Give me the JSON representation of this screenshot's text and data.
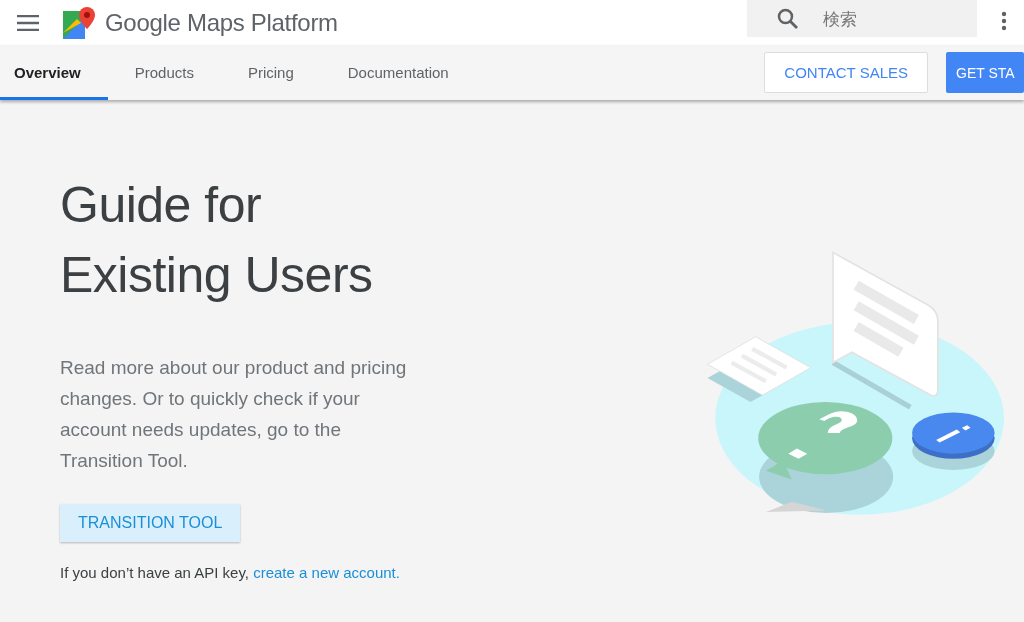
{
  "header": {
    "brand": "Google Maps Platform",
    "search": {
      "placeholder": "検索"
    }
  },
  "tabs": [
    {
      "label": "Overview",
      "selected": true
    },
    {
      "label": "Products",
      "selected": false
    },
    {
      "label": "Pricing",
      "selected": false
    },
    {
      "label": "Documentation",
      "selected": false
    }
  ],
  "actions": [
    {
      "label": "CONTACT SALES",
      "kind": "outlined"
    },
    {
      "label": "GET STA",
      "kind": "filled"
    }
  ],
  "hero": {
    "title_lines": [
      "Guide for",
      "Existing Users"
    ],
    "body": "Read more about our product and pricing changes. Or to quickly check if your account needs updates, go to the Transition Tool.",
    "button": "TRANSITION TOOL",
    "note": "If you don’t have an API key,",
    "link": "create a new account."
  }
}
